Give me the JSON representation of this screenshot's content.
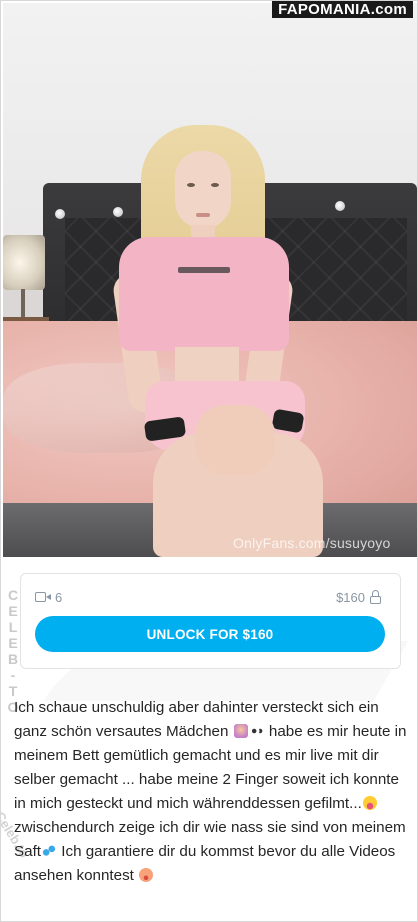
{
  "header": {
    "site_watermark": "FAPOMANIA.com"
  },
  "photo": {
    "overlay_text": "OnlyFans.com/susuyoyo"
  },
  "side_watermark": {
    "letters": [
      "C",
      "E",
      "L",
      "E",
      "B",
      "-",
      "T",
      "O"
    ],
    "bottom_text": "Celeb.to"
  },
  "unlock_card": {
    "video_count": "6",
    "video_icon": "video-camera-icon",
    "price": "$160",
    "lock_icon": "lock-icon",
    "button_label": "UNLOCK FOR $160",
    "accent_color": "#00aff0"
  },
  "post": {
    "segments": [
      "Ich schaue unschuldig aber dahinter versteckt sich ein ganz schön versautes Mädchen ",
      " habe es mir heute in meinem Bett gemütlich gemacht und es mir live mit dir selber gemacht ... habe meine 2 Finger soweit ich konnte in mich gesteckt und mich währenddessen gefilmt...",
      " zwischendurch zeige ich dir wie nass sie sind von meinem Saft",
      " Ich garantiere dir du kommst bevor du alle Videos ansehen konntest "
    ],
    "emojis": [
      "woman-gesturing-emoji",
      "eyes-emoji",
      "tongue-emoji",
      "sweat-droplets-emoji",
      "flushed-emoji"
    ]
  }
}
